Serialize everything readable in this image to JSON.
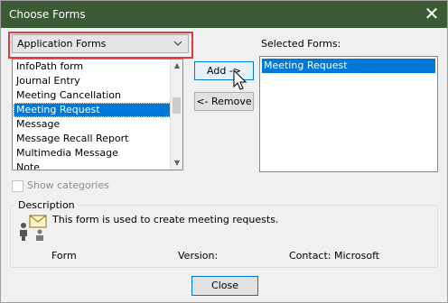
{
  "window": {
    "title": "Choose Forms",
    "close_glyph": "✕",
    "titlebar_color": "#3c5a36"
  },
  "forms_source": {
    "selected": "Application Forms",
    "chevron_icon": "chevron-down-icon",
    "highlight_color": "#e23b3b"
  },
  "forms_list": {
    "items": [
      "InfoPath form",
      "Journal Entry",
      "Meeting Cancellation",
      "Meeting Request",
      "Message",
      "Message Recall Report",
      "Multimedia Message",
      "Note"
    ],
    "selected_index": 3
  },
  "buttons": {
    "add_label": "Add ->",
    "remove_label": "<- Remove",
    "close_label": "Close"
  },
  "selected_forms": {
    "label": "Selected Forms:",
    "items": [
      "Meeting Request"
    ]
  },
  "show_categories": {
    "label": "Show categories",
    "checked": false,
    "enabled": false
  },
  "description": {
    "legend": "Description",
    "text": "This form is used to create meeting requests.",
    "form_label": "Form",
    "version_label": "Version:",
    "contact_label": "Contact: Microsoft"
  },
  "accent_color": "#0078d7"
}
